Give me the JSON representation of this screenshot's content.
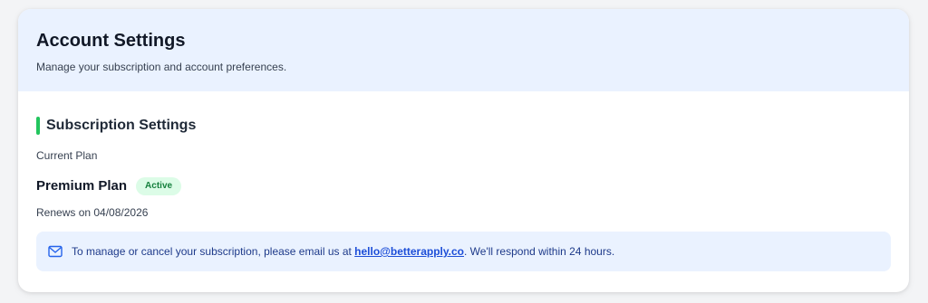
{
  "header": {
    "title": "Account Settings",
    "subtitle": "Manage your subscription and account preferences."
  },
  "subscription": {
    "section_title": "Subscription Settings",
    "current_plan_label": "Current Plan",
    "plan_name": "Premium Plan",
    "status": "Active",
    "renewal": "Renews on 04/08/2026"
  },
  "notice": {
    "icon": "mail-icon",
    "text_before": "To manage or cancel your subscription, please email us at ",
    "email": "hello@betterapply.co",
    "text_after": ". We'll respond within 24 hours."
  },
  "colors": {
    "accent_green": "#22c55e",
    "header_bg": "#eaf2ff",
    "link_blue": "#1d4ed8"
  }
}
